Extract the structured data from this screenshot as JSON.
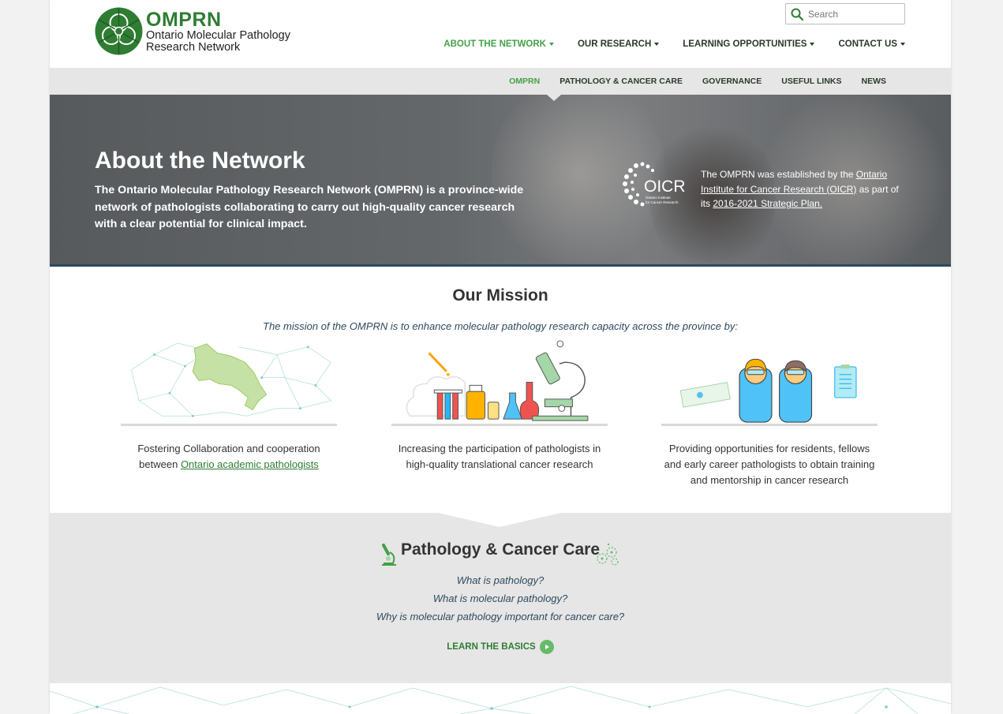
{
  "brand": {
    "acronym": "OMPRN",
    "full_name": "Ontario Molecular Pathology Research Network",
    "color": "#2e7d32"
  },
  "search": {
    "placeholder": "Search",
    "icon": "search-icon"
  },
  "main_nav": [
    {
      "label": "ABOUT THE NETWORK",
      "active": true
    },
    {
      "label": "OUR RESEARCH",
      "active": false
    },
    {
      "label": "LEARNING OPPORTUNITIES",
      "active": false
    },
    {
      "label": "CONTACT US",
      "active": false
    }
  ],
  "sub_nav": [
    {
      "label": "OMPRN",
      "active": true
    },
    {
      "label": "PATHOLOGY & CANCER CARE",
      "active": false
    },
    {
      "label": "GOVERNANCE",
      "active": false
    },
    {
      "label": "USEFUL LINKS",
      "active": false
    },
    {
      "label": "NEWS",
      "active": false
    }
  ],
  "hero": {
    "title": "About the Network",
    "lead": "The Ontario Molecular Pathology Research Network (OMPRN) is a province-wide network of pathologists collaborating to carry out high-quality cancer research with a clear potential for clinical impact.",
    "oicr_logo_text": "OICR",
    "oicr_logo_sub": "Ontario Institute for Cancer Research",
    "note_prefix": "The OMPRN was established by the ",
    "note_link1": "Ontario Institute for Cancer Research (OICR)",
    "note_middle": " as part of its ",
    "note_link2": "2016-2021 Strategic Plan."
  },
  "mission": {
    "title": "Our Mission",
    "subtitle": "The mission of the OMPRN is to enhance molecular pathology research capacity across the province by:",
    "items": [
      {
        "text_before": "Fostering Collaboration and cooperation between ",
        "link": "Ontario academic pathologists",
        "illustration": "ontario-network-map-illustration"
      },
      {
        "text_before": "Increasing the participation of pathologists in high-quality translational cancer research",
        "link": "",
        "illustration": "lab-equipment-illustration"
      },
      {
        "text_before": "Providing opportunities for residents, fellows and early career pathologists to obtain training and mentorship in cancer research",
        "link": "",
        "illustration": "pathologists-illustration"
      }
    ]
  },
  "pathology": {
    "title": "Pathology & Cancer Care",
    "questions": [
      "What is pathology?",
      "What is molecular pathology?",
      "Why is molecular pathology important for cancer care?"
    ],
    "cta": "LEARN THE BASICS"
  },
  "colors": {
    "accent_green": "#43a047",
    "dark_green": "#2e7d32",
    "nav_text": "#2a3a2a",
    "italic_blue": "#2e4a5e",
    "section_grey": "#e6e6e6"
  }
}
